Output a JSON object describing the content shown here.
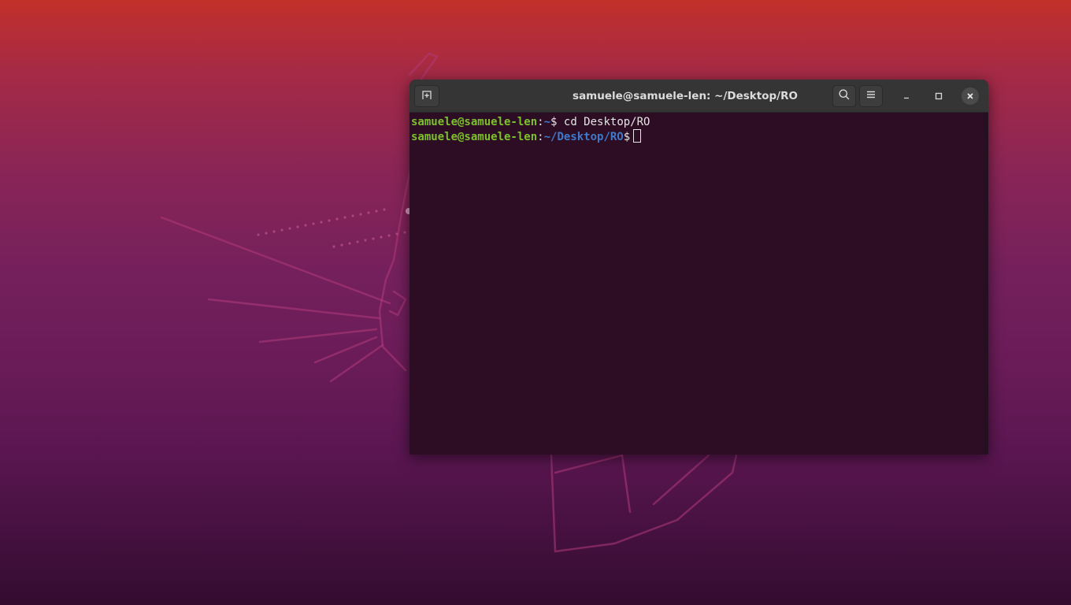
{
  "window": {
    "title": "samuele@samuele-len: ~/Desktop/RO"
  },
  "terminal": {
    "lines": [
      {
        "user_host": "samuele@samuele-len",
        "colon": ":",
        "path": "~",
        "dollar": "$",
        "command": " cd Desktop/RO"
      },
      {
        "user_host": "samuele@samuele-len",
        "colon": ":",
        "path": "~/Desktop/RO",
        "dollar": "$",
        "command": ""
      }
    ]
  },
  "icons": {
    "new_tab": "new-tab-icon",
    "search": "search-icon",
    "menu": "hamburger-menu-icon",
    "minimize": "minimize-icon",
    "maximize": "maximize-icon",
    "close": "close-icon"
  },
  "colors": {
    "prompt_user": "#7cc12b",
    "prompt_path": "#3f79c9",
    "terminal_background": "#2c0d24",
    "titlebar": "#353535"
  }
}
